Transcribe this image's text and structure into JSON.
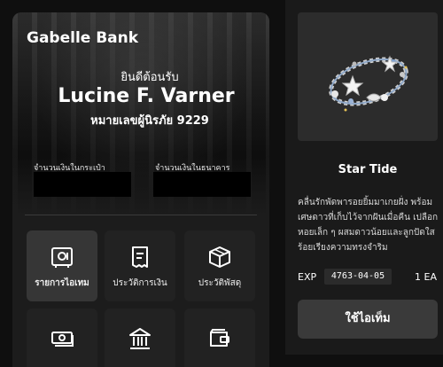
{
  "bank": {
    "name": "Gabelle Bank"
  },
  "profile": {
    "welcome": "ยินดีต้อนรับ",
    "name": "Lucine F. Varner",
    "passport": "หมายเลขผู้นิรภัย 9229"
  },
  "balances": {
    "wallet_label": "จำนวนเงินในกระเป๋า",
    "bank_label": "จำนวนเงินในธนาคาร"
  },
  "menu": {
    "tiles": [
      {
        "label": "รายการไอเทม",
        "icon": "safe-icon",
        "active": true
      },
      {
        "label": "ประวัติการเงิน",
        "icon": "receipt-icon",
        "active": false
      },
      {
        "label": "ประวัติพัสดุ",
        "icon": "package-icon",
        "active": false
      },
      {
        "label": "",
        "icon": "cash-icon",
        "active": false
      },
      {
        "label": "",
        "icon": "bank-icon",
        "active": false
      },
      {
        "label": "",
        "icon": "wallet-icon",
        "active": false
      }
    ]
  },
  "item": {
    "name": "Star Tide",
    "image": "starfish-shell-bracelet",
    "description": "คลื่นรักพัดพารอยยิ้มมาเกยฝั่ง พร้อมเศษดาวที่เก็บไว้จากฝันเมื่อคืน เปลือกหอยเล็ก ๆ ผสมดาวน้อยและลูกปัดใส ร้อยเรียงความทรงจำริม",
    "exp_label": "EXP",
    "exp_value": "4763-04-05",
    "quantity": "1 EA",
    "use_label": "ใช้ไอเท็ม"
  }
}
